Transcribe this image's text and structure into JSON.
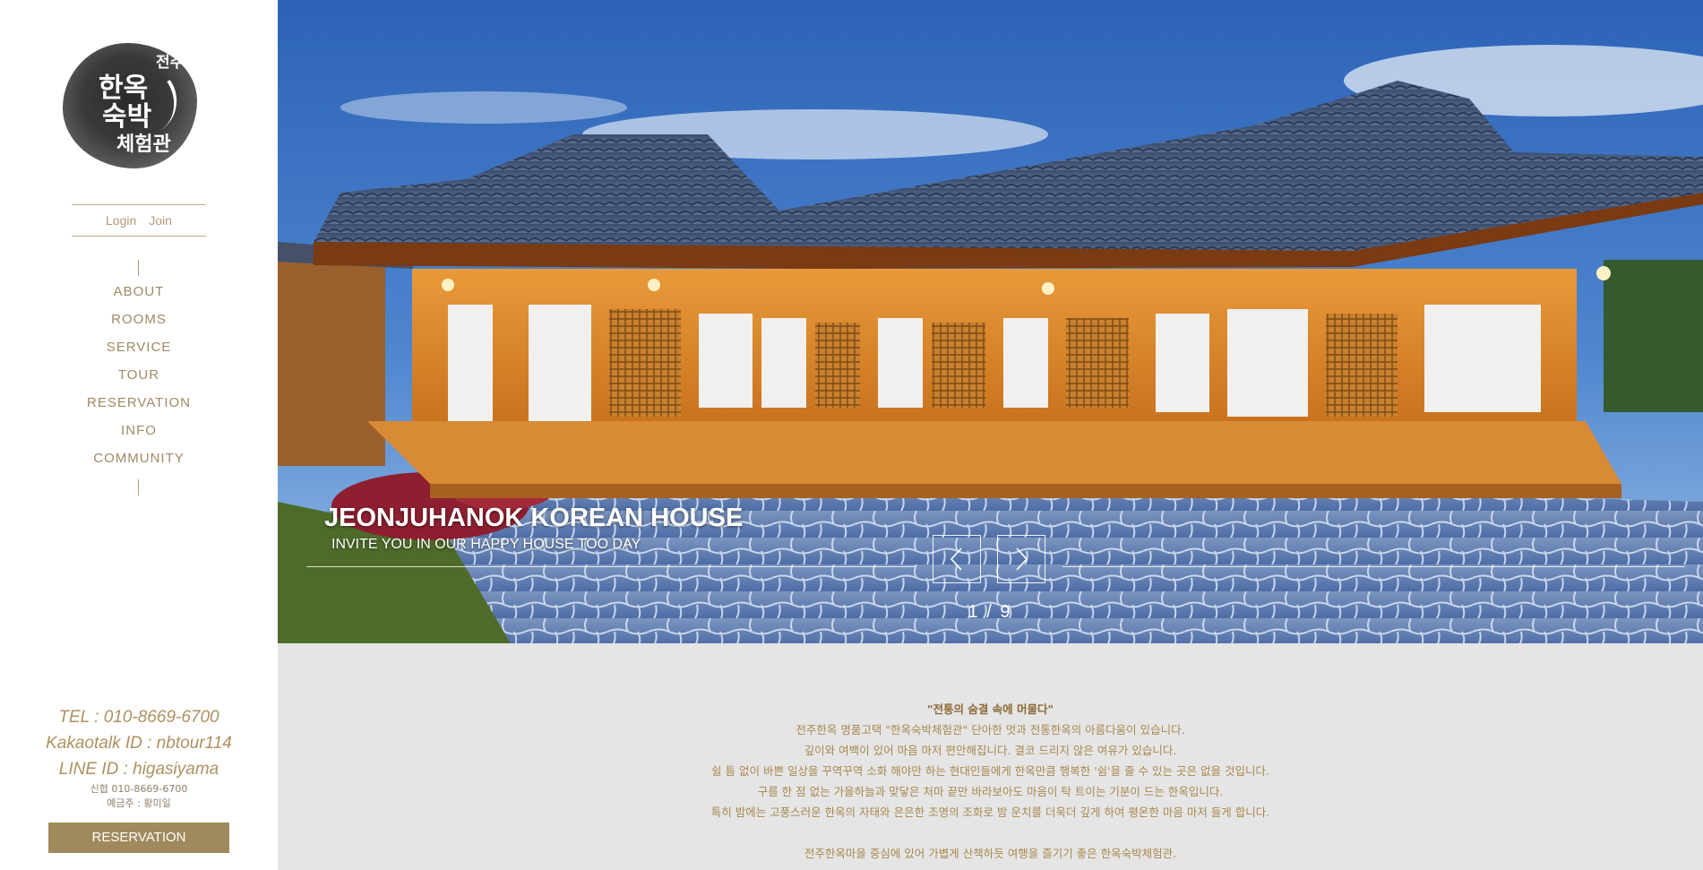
{
  "sidebar": {
    "logo": {
      "glyphs": [
        "한옥",
        "숙박",
        "체험관",
        "전주"
      ]
    },
    "auth": {
      "login": "Login",
      "join": "Join"
    },
    "nav": [
      {
        "label": "ABOUT"
      },
      {
        "label": "ROOMS"
      },
      {
        "label": "SERVICE"
      },
      {
        "label": "TOUR"
      },
      {
        "label": "RESERVATION"
      },
      {
        "label": "INFO"
      },
      {
        "label": "COMMUNITY"
      }
    ],
    "contact": {
      "tel": "TEL : 010-8669-6700",
      "kakao": "Kakaotalk ID : nbtour114",
      "line": "LINE ID : higasiyama",
      "bank": "신협 010-8669-6700",
      "holder": "예금주 : 황미일"
    },
    "reserve_button": "RESERVATION"
  },
  "hero": {
    "title": "JEONJUHANOK KOREAN HOUSE",
    "subtitle": "INVITE YOU IN OUR HAPPY HOUSE TOO DAY",
    "counter": "1 / 9",
    "prev_icon": "chevron-left-icon",
    "next_icon": "chevron-right-icon"
  },
  "intro": {
    "heading": "\"전통의 숨결 속에 머물다\"",
    "lines": [
      "전주한옥 명품고택 \"한옥숙박체험관\" 단아한 멋과 전통한옥의 아름다움이 있습니다.",
      "깊이와 여백이 있어 마음 마저 편안해집니다. 결코 드리지 않은 여유가 있습니다.",
      "쉴 틈 없이 바쁜 일상을 꾸역꾸역 소화 해야만 하는 현대인들에게 한옥만큼 행복한 '쉼'을 줄 수 있는 곳은 없을 것입니다.",
      "구름 한 점 없는 가을하늘과 맞닿은 처마 끝만 바라보아도 마음이 탁 트이는 기분이 드는 한옥입니다.",
      "특히 밤에는 고풍스러운 한옥의 자태와 은은한 조명의 조화로 밤 운치를 더욱더 깊게 하여 평온한 마음 마저 들게 합니다."
    ],
    "lines2": [
      "전주한옥마을 중심에 있어 가볍게 산책하듯 여행을 즐기기 좋은 한옥숙박체험관."
    ]
  },
  "colors": {
    "accent_gold": "#a08a5d",
    "nav_text": "#a08a64",
    "intro_bg": "#e5e5e5",
    "intro_text": "#a8884f"
  }
}
